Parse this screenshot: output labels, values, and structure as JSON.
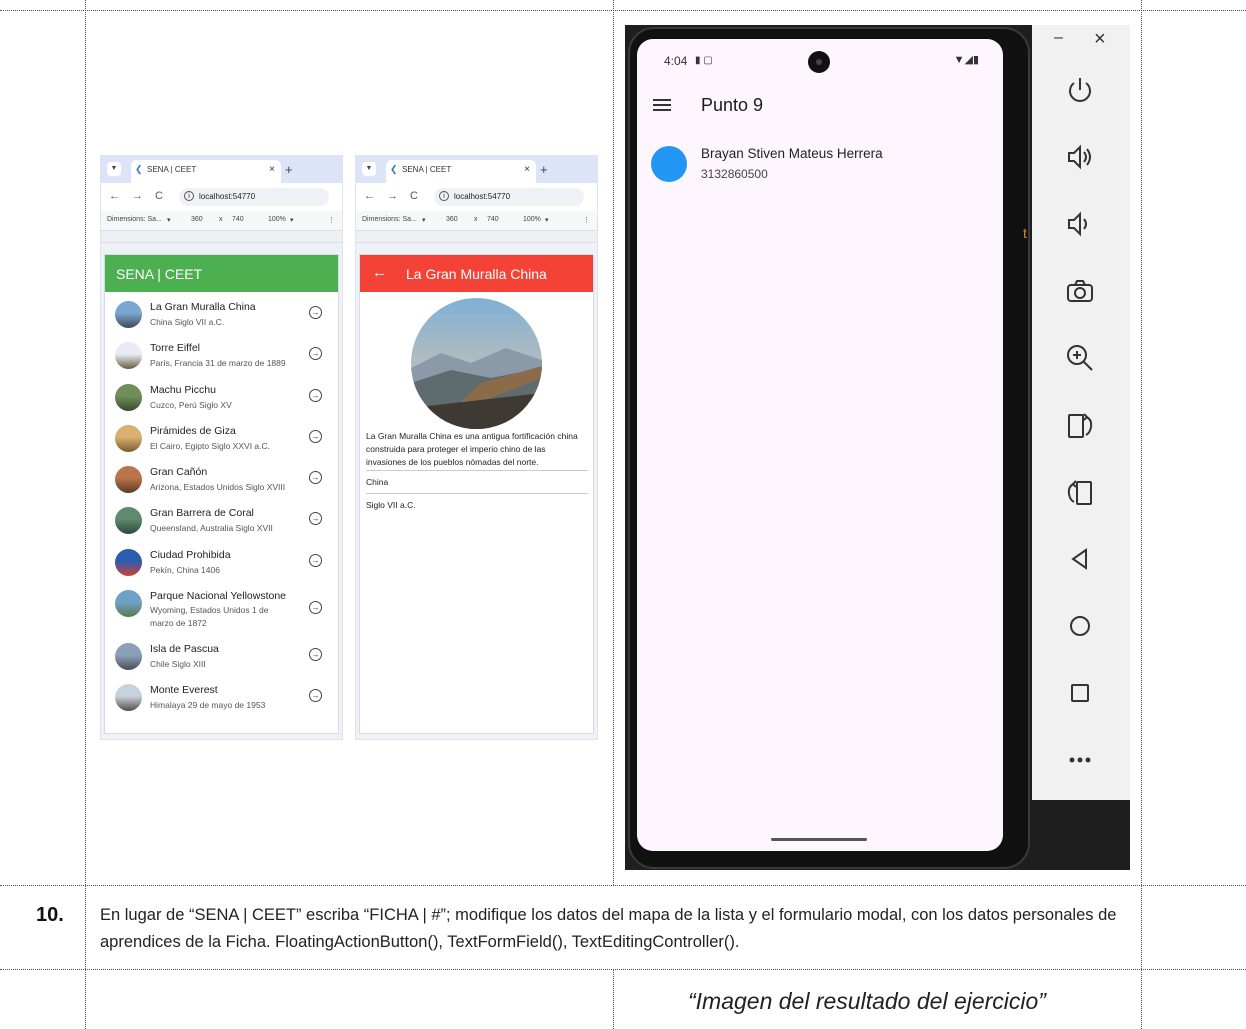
{
  "document": {
    "row_number": "10.",
    "instruction": "En lugar de “SENA | CEET” escriba “FICHA | #”; modifique los datos del mapa de la lista y el formulario modal, con los datos personales de aprendices de la Ficha. FloatingActionButton(), TextFormField(), TextEditingController().",
    "caption": "“Imagen del resultado del ejercicio”"
  },
  "browser": {
    "tab_title": "SENA | CEET",
    "url": "localhost:54770",
    "dimensions_label": "Dimensions: Sa...",
    "width": "360",
    "times": "x",
    "height": "740",
    "zoom": "100%"
  },
  "list_app": {
    "title": "SENA | CEET",
    "items": [
      {
        "title": "La Gran Muralla China",
        "subtitle": "China Siglo VII a.C."
      },
      {
        "title": "Torre Eiffel",
        "subtitle": "París, Francia 31 de marzo de 1889"
      },
      {
        "title": "Machu Picchu",
        "subtitle": "Cuzco, Perú Siglo XV"
      },
      {
        "title": "Pirámides de Giza",
        "subtitle": "El Cairo, Egipto Siglo XXVI a.C."
      },
      {
        "title": "Gran Cañón",
        "subtitle": "Arizona, Estados Unidos Siglo XVIII"
      },
      {
        "title": "Gran Barrera de Coral",
        "subtitle": "Queensland, Australia Siglo XVII"
      },
      {
        "title": "Ciudad Prohibida",
        "subtitle": "Pekín, China 1406"
      },
      {
        "title": "Parque Nacional Yellowstone",
        "subtitle": "Wyoming, Estados Unidos 1 de marzo de 1872"
      },
      {
        "title": "Isla de Pascua",
        "subtitle": "Chile Siglo XIII"
      },
      {
        "title": "Monte Everest",
        "subtitle": "Himalaya 29 de mayo de 1953"
      }
    ]
  },
  "detail_app": {
    "title": "La Gran Muralla China",
    "description": "La Gran Muralla China es una antigua fortificación china construida para proteger el imperio chino de las invasiones de los pueblos nómadas del norte.",
    "country": "China",
    "era": "Siglo VII a.C."
  },
  "phone": {
    "time": "4:04",
    "app_title": "Punto 9",
    "contact_name": "Brayan Stiven Mateus Herrera",
    "contact_phone": "3132860500"
  },
  "emulator": {
    "minimize": "–",
    "close": "×"
  },
  "colors": {
    "green_appbar": "#4caf50",
    "red_appbar": "#f44336",
    "contact_avatar": "#2196f3"
  }
}
